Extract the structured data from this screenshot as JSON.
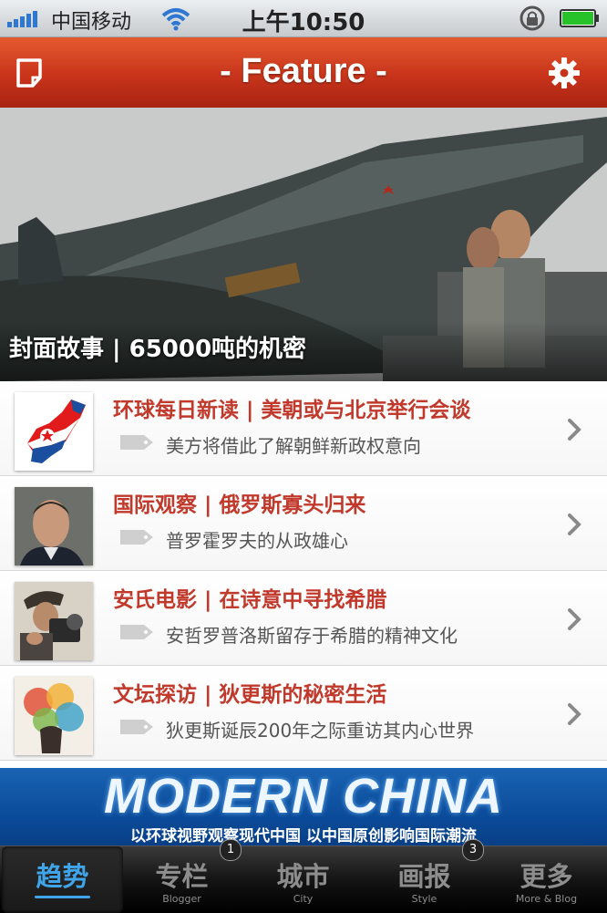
{
  "status_bar": {
    "carrier": "中国移动",
    "time": "上午10:50"
  },
  "nav": {
    "title": "- Feature -"
  },
  "hero": {
    "caption": "封面故事 | 65000吨的机密"
  },
  "articles": [
    {
      "title": "环球每日新读 | 美朝或与北京举行会谈",
      "summary": "美方将借此了解朝鲜新政权意向",
      "thumb_icon": "north-korea-map-icon"
    },
    {
      "title": "国际观察 | 俄罗斯寡头归来",
      "summary": "普罗霍罗夫的从政雄心",
      "thumb_icon": "portrait-icon"
    },
    {
      "title": "安氏电影 | 在诗意中寻找希腊",
      "summary": "安哲罗普洛斯留存于希腊的精神文化",
      "thumb_icon": "film-camera-icon"
    },
    {
      "title": "文坛探访 | 狄更斯的秘密生活",
      "summary": "狄更斯诞辰200年之际重访其内心世界",
      "thumb_icon": "colorful-portrait-icon"
    }
  ],
  "banner": {
    "headline": "MODERN CHINA",
    "tagline": "以环球视野观察现代中国  以中国原创影响国际潮流"
  },
  "tabs": [
    {
      "label": "趋势",
      "sub": "",
      "badge": "",
      "active": true
    },
    {
      "label": "专栏",
      "sub": "Blogger",
      "badge": "1",
      "active": false
    },
    {
      "label": "城市",
      "sub": "City",
      "badge": "",
      "active": false
    },
    {
      "label": "画报",
      "sub": "Style",
      "badge": "3",
      "active": false
    },
    {
      "label": "更多",
      "sub": "More & Blog",
      "badge": "",
      "active": false
    }
  ],
  "colors": {
    "nav_red": "#c8341b",
    "title_red": "#c0392b",
    "tab_active": "#3fa4e8",
    "banner_blue": "#0b4c9b"
  }
}
